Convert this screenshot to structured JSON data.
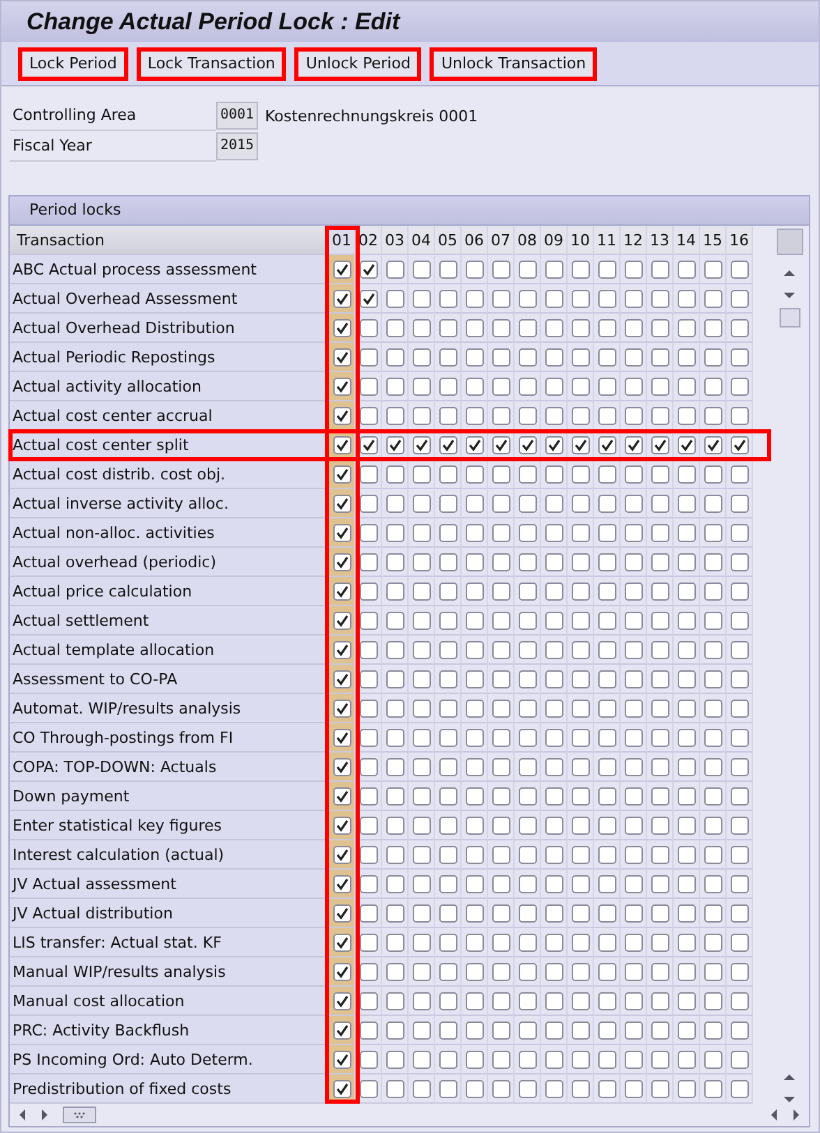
{
  "window": {
    "title": "Change Actual Period Lock : Edit"
  },
  "toolbar": [
    {
      "label": "Lock Period",
      "highlighted": true
    },
    {
      "label": "Lock Transaction",
      "highlighted": true
    },
    {
      "label": "Unlock Period",
      "highlighted": true
    },
    {
      "label": "Unlock Transaction",
      "highlighted": true
    }
  ],
  "fields": [
    {
      "label": "Controlling Area",
      "value": "0001",
      "description": "Kostenrechnungskreis 0001"
    },
    {
      "label": "Fiscal Year",
      "value": "2015"
    }
  ],
  "period_locks": {
    "title": "Period locks",
    "first_column": "Transaction",
    "columns": [
      {
        "label": "01",
        "selected": true,
        "highlighted": true
      },
      {
        "label": "02",
        "selected": false,
        "highlighted": false
      },
      {
        "label": "03",
        "selected": false,
        "highlighted": false
      },
      {
        "label": "04",
        "selected": false,
        "highlighted": false
      },
      {
        "label": "05",
        "selected": false,
        "highlighted": false
      },
      {
        "label": "06",
        "selected": false,
        "highlighted": false
      },
      {
        "label": "07",
        "selected": false,
        "highlighted": false
      },
      {
        "label": "08",
        "selected": false,
        "highlighted": false
      },
      {
        "label": "09",
        "selected": false,
        "highlighted": false
      },
      {
        "label": "10",
        "selected": false,
        "highlighted": false
      },
      {
        "label": "11",
        "selected": false,
        "highlighted": false
      },
      {
        "label": "12",
        "selected": false,
        "highlighted": false
      },
      {
        "label": "13",
        "selected": false,
        "highlighted": false
      },
      {
        "label": "14",
        "selected": false,
        "highlighted": false
      },
      {
        "label": "15",
        "selected": false,
        "highlighted": false
      },
      {
        "label": "16",
        "selected": false,
        "highlighted": false
      }
    ],
    "rows": [
      {
        "label": "ABC Actual process assessment",
        "highlighted": false,
        "checked": [
          true,
          true,
          false,
          false,
          false,
          false,
          false,
          false,
          false,
          false,
          false,
          false,
          false,
          false,
          false,
          false
        ]
      },
      {
        "label": "Actual Overhead Assessment",
        "highlighted": false,
        "checked": [
          true,
          true,
          false,
          false,
          false,
          false,
          false,
          false,
          false,
          false,
          false,
          false,
          false,
          false,
          false,
          false
        ]
      },
      {
        "label": "Actual Overhead Distribution",
        "highlighted": false,
        "checked": [
          true,
          false,
          false,
          false,
          false,
          false,
          false,
          false,
          false,
          false,
          false,
          false,
          false,
          false,
          false,
          false
        ]
      },
      {
        "label": "Actual Periodic Repostings",
        "highlighted": false,
        "checked": [
          true,
          false,
          false,
          false,
          false,
          false,
          false,
          false,
          false,
          false,
          false,
          false,
          false,
          false,
          false,
          false
        ]
      },
      {
        "label": "Actual activity allocation",
        "highlighted": false,
        "checked": [
          true,
          false,
          false,
          false,
          false,
          false,
          false,
          false,
          false,
          false,
          false,
          false,
          false,
          false,
          false,
          false
        ]
      },
      {
        "label": "Actual cost center accrual",
        "highlighted": false,
        "checked": [
          true,
          false,
          false,
          false,
          false,
          false,
          false,
          false,
          false,
          false,
          false,
          false,
          false,
          false,
          false,
          false
        ]
      },
      {
        "label": "Actual cost center split",
        "highlighted": true,
        "checked": [
          true,
          true,
          true,
          true,
          true,
          true,
          true,
          true,
          true,
          true,
          true,
          true,
          true,
          true,
          true,
          true
        ]
      },
      {
        "label": "Actual cost distrib. cost obj.",
        "highlighted": false,
        "checked": [
          true,
          false,
          false,
          false,
          false,
          false,
          false,
          false,
          false,
          false,
          false,
          false,
          false,
          false,
          false,
          false
        ]
      },
      {
        "label": "Actual inverse activity alloc.",
        "highlighted": false,
        "checked": [
          true,
          false,
          false,
          false,
          false,
          false,
          false,
          false,
          false,
          false,
          false,
          false,
          false,
          false,
          false,
          false
        ]
      },
      {
        "label": "Actual non-alloc. activities",
        "highlighted": false,
        "checked": [
          true,
          false,
          false,
          false,
          false,
          false,
          false,
          false,
          false,
          false,
          false,
          false,
          false,
          false,
          false,
          false
        ]
      },
      {
        "label": "Actual overhead (periodic)",
        "highlighted": false,
        "checked": [
          true,
          false,
          false,
          false,
          false,
          false,
          false,
          false,
          false,
          false,
          false,
          false,
          false,
          false,
          false,
          false
        ]
      },
      {
        "label": "Actual price calculation",
        "highlighted": false,
        "checked": [
          true,
          false,
          false,
          false,
          false,
          false,
          false,
          false,
          false,
          false,
          false,
          false,
          false,
          false,
          false,
          false
        ]
      },
      {
        "label": "Actual settlement",
        "highlighted": false,
        "checked": [
          true,
          false,
          false,
          false,
          false,
          false,
          false,
          false,
          false,
          false,
          false,
          false,
          false,
          false,
          false,
          false
        ]
      },
      {
        "label": "Actual template allocation",
        "highlighted": false,
        "checked": [
          true,
          false,
          false,
          false,
          false,
          false,
          false,
          false,
          false,
          false,
          false,
          false,
          false,
          false,
          false,
          false
        ]
      },
      {
        "label": "Assessment to CO-PA",
        "highlighted": false,
        "checked": [
          true,
          false,
          false,
          false,
          false,
          false,
          false,
          false,
          false,
          false,
          false,
          false,
          false,
          false,
          false,
          false
        ]
      },
      {
        "label": "Automat. WIP/results analysis",
        "highlighted": false,
        "checked": [
          true,
          false,
          false,
          false,
          false,
          false,
          false,
          false,
          false,
          false,
          false,
          false,
          false,
          false,
          false,
          false
        ]
      },
      {
        "label": "CO Through-postings from FI",
        "highlighted": false,
        "checked": [
          true,
          false,
          false,
          false,
          false,
          false,
          false,
          false,
          false,
          false,
          false,
          false,
          false,
          false,
          false,
          false
        ]
      },
      {
        "label": "COPA: TOP-DOWN: Actuals",
        "highlighted": false,
        "checked": [
          true,
          false,
          false,
          false,
          false,
          false,
          false,
          false,
          false,
          false,
          false,
          false,
          false,
          false,
          false,
          false
        ]
      },
      {
        "label": "Down payment",
        "highlighted": false,
        "checked": [
          true,
          false,
          false,
          false,
          false,
          false,
          false,
          false,
          false,
          false,
          false,
          false,
          false,
          false,
          false,
          false
        ]
      },
      {
        "label": "Enter statistical key figures",
        "highlighted": false,
        "checked": [
          true,
          false,
          false,
          false,
          false,
          false,
          false,
          false,
          false,
          false,
          false,
          false,
          false,
          false,
          false,
          false
        ]
      },
      {
        "label": "Interest calculation (actual)",
        "highlighted": false,
        "checked": [
          true,
          false,
          false,
          false,
          false,
          false,
          false,
          false,
          false,
          false,
          false,
          false,
          false,
          false,
          false,
          false
        ]
      },
      {
        "label": "JV Actual assessment",
        "highlighted": false,
        "checked": [
          true,
          false,
          false,
          false,
          false,
          false,
          false,
          false,
          false,
          false,
          false,
          false,
          false,
          false,
          false,
          false
        ]
      },
      {
        "label": "JV Actual distribution",
        "highlighted": false,
        "checked": [
          true,
          false,
          false,
          false,
          false,
          false,
          false,
          false,
          false,
          false,
          false,
          false,
          false,
          false,
          false,
          false
        ]
      },
      {
        "label": "LIS transfer: Actual stat. KF",
        "highlighted": false,
        "checked": [
          true,
          false,
          false,
          false,
          false,
          false,
          false,
          false,
          false,
          false,
          false,
          false,
          false,
          false,
          false,
          false
        ]
      },
      {
        "label": "Manual WIP/results analysis",
        "highlighted": false,
        "checked": [
          true,
          false,
          false,
          false,
          false,
          false,
          false,
          false,
          false,
          false,
          false,
          false,
          false,
          false,
          false,
          false
        ]
      },
      {
        "label": "Manual cost allocation",
        "highlighted": false,
        "checked": [
          true,
          false,
          false,
          false,
          false,
          false,
          false,
          false,
          false,
          false,
          false,
          false,
          false,
          false,
          false,
          false
        ]
      },
      {
        "label": "PRC: Activity Backflush",
        "highlighted": false,
        "checked": [
          true,
          false,
          false,
          false,
          false,
          false,
          false,
          false,
          false,
          false,
          false,
          false,
          false,
          false,
          false,
          false
        ]
      },
      {
        "label": "PS Incoming Ord: Auto Determ.",
        "highlighted": false,
        "checked": [
          true,
          false,
          false,
          false,
          false,
          false,
          false,
          false,
          false,
          false,
          false,
          false,
          false,
          false,
          false,
          false
        ]
      },
      {
        "label": "Predistribution of fixed costs",
        "highlighted": false,
        "checked": [
          true,
          false,
          false,
          false,
          false,
          false,
          false,
          false,
          false,
          false,
          false,
          false,
          false,
          false,
          false,
          false
        ]
      }
    ]
  }
}
